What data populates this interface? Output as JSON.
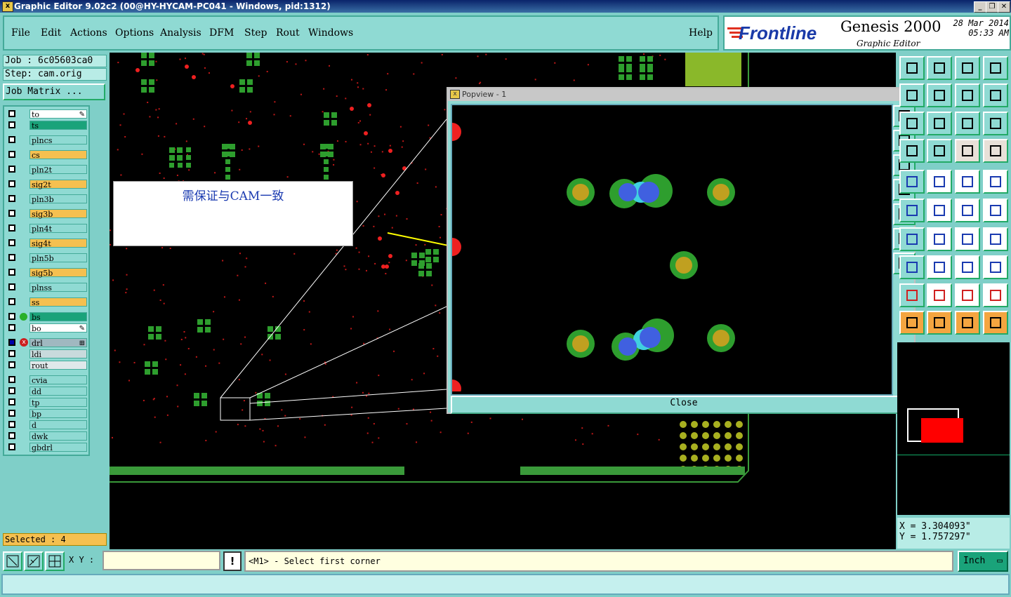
{
  "window": {
    "title": "Graphic Editor 9.02c2 (00@HY-HYCAM-PC041 - Windows, pid:1312)",
    "app_icon": "x-window-icon",
    "controls": [
      "minimize",
      "maximize",
      "close"
    ]
  },
  "menu": {
    "items": [
      "File",
      "Edit",
      "Actions",
      "Options",
      "Analysis",
      "DFM",
      "Step",
      "Rout",
      "Windows"
    ],
    "help": "Help"
  },
  "logo": {
    "brand": "Frontline",
    "product": "Genesis 2000",
    "subtitle": "Graphic Editor",
    "date": "28 Mar 2014",
    "time": "05:33 AM"
  },
  "job": {
    "job_label": "Job : 6c05603ca0",
    "step_label": "Step: cam.orig",
    "matrix_button": "Job Matrix ..."
  },
  "layers": [
    {
      "name": "to",
      "color": "#ffffff",
      "suffix": "✎"
    },
    {
      "name": "ts",
      "color": "#1aa37a"
    },
    {
      "name": "plncs",
      "color": "#8fdad3"
    },
    {
      "name": "cs",
      "color": "#f5c050"
    },
    {
      "name": "pln2t",
      "color": "#8fdad3"
    },
    {
      "name": "sig2t",
      "color": "#f5c050"
    },
    {
      "name": "pln3b",
      "color": "#8fdad3"
    },
    {
      "name": "sig3b",
      "color": "#f5c050"
    },
    {
      "name": "pln4t",
      "color": "#8fdad3"
    },
    {
      "name": "sig4t",
      "color": "#f5c050"
    },
    {
      "name": "pln5b",
      "color": "#8fdad3"
    },
    {
      "name": "sig5b",
      "color": "#f5c050"
    },
    {
      "name": "plnss",
      "color": "#8fdad3"
    },
    {
      "name": "ss",
      "color": "#f5c050"
    },
    {
      "name": "bs",
      "color": "#1aa37a",
      "dot": "#2ab02a"
    },
    {
      "name": "bo",
      "color": "#ffffff",
      "suffix": "✎"
    },
    {
      "name": "drl",
      "color": "#a0b8c0",
      "marker": "#cc2020",
      "suffix": "⊞"
    },
    {
      "name": "ldi",
      "color": "#c8dadc"
    },
    {
      "name": "rout",
      "color": "#e0e8ea"
    },
    {
      "name": "cvia",
      "color": "#8fdad3"
    },
    {
      "name": "dd",
      "color": "#8fdad3"
    },
    {
      "name": "tp",
      "color": "#8fdad3"
    },
    {
      "name": "bp",
      "color": "#8fdad3"
    },
    {
      "name": "d",
      "color": "#8fdad3"
    },
    {
      "name": "dwk",
      "color": "#8fdad3"
    },
    {
      "name": "gbdrl",
      "color": "#8fdad3"
    }
  ],
  "annotation": {
    "text": "需保证与CAM一致"
  },
  "popview": {
    "title": "Popview - 1",
    "close": "Close"
  },
  "coords": {
    "x": "X = 3.304093\"",
    "y": "Y = 1.757297\""
  },
  "status": {
    "selected": "Selected : 4",
    "xy_label": "X Y :",
    "xy_value": "",
    "message": "<M1> - Select first corner",
    "units": "Inch",
    "alert": "!"
  },
  "colors": {
    "panel": "#8fdad3",
    "pad_green": "#2e9e2e",
    "pad_gold": "#c0a020",
    "drill_blue": "#4060e0",
    "via_red": "#ee2020"
  }
}
